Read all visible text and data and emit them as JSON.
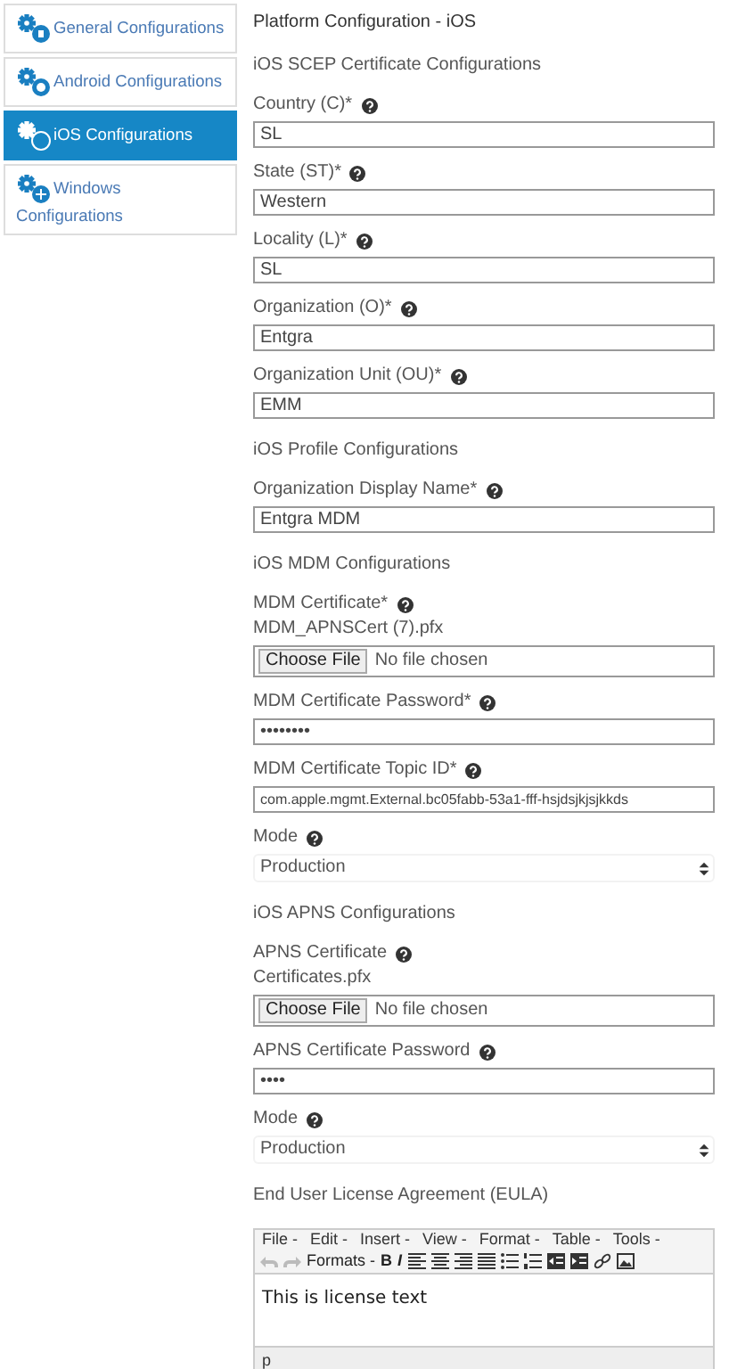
{
  "sidebar": {
    "items": [
      {
        "label": "General Configurations",
        "selected": false
      },
      {
        "label": "Android Configurations",
        "selected": false
      },
      {
        "label": "iOS Configurations",
        "selected": true
      },
      {
        "label": "Windows Configurations",
        "selected": false
      }
    ]
  },
  "page_title": "Platform Configuration - iOS",
  "form": [
    {
      "kind": "section",
      "label": "iOS SCEP Certificate Configurations"
    },
    {
      "kind": "text",
      "label": "Country (C)*",
      "value": "SL"
    },
    {
      "kind": "text",
      "label": "State (ST)*",
      "value": "Western"
    },
    {
      "kind": "text",
      "label": "Locality (L)*",
      "value": "SL"
    },
    {
      "kind": "text",
      "label": "Organization (O)*",
      "value": "Entgra"
    },
    {
      "kind": "text",
      "label": "Organization Unit (OU)*",
      "value": "EMM"
    },
    {
      "kind": "section",
      "label": "iOS Profile Configurations"
    },
    {
      "kind": "text",
      "label": "Organization Display Name*",
      "value": "Entgra MDM"
    },
    {
      "kind": "section",
      "label": "iOS MDM Configurations"
    },
    {
      "kind": "file",
      "label": "MDM Certificate*",
      "current": "MDM_APNSCert (7).pfx",
      "button": "Choose File",
      "status": "No file chosen"
    },
    {
      "kind": "text",
      "label": "MDM Certificate Password*",
      "value": "••••••••"
    },
    {
      "kind": "text",
      "label": "MDM Certificate Topic ID*",
      "value": "com.apple.mgmt.External.bc05fabb-53a1-fff-hsjdsjkjsjkkds"
    },
    {
      "kind": "select",
      "label": "Mode",
      "value": "Production"
    },
    {
      "kind": "section",
      "label": "iOS APNS Configurations"
    },
    {
      "kind": "file",
      "label": "APNS Certificate",
      "current": "Certificates.pfx",
      "button": "Choose File",
      "status": "No file chosen"
    },
    {
      "kind": "text",
      "label": "APNS Certificate Password",
      "value": "••••"
    },
    {
      "kind": "select",
      "label": "Mode",
      "value": "Production"
    },
    {
      "kind": "editor",
      "label": "End User License Agreement (EULA)",
      "menu": [
        "File -",
        "Edit -",
        "Insert -",
        "View -",
        "Format -",
        "Table -",
        "Tools -"
      ],
      "formats": "Formats -",
      "bold": "B",
      "italic": "I",
      "content": "This is license text",
      "path": "p"
    }
  ]
}
